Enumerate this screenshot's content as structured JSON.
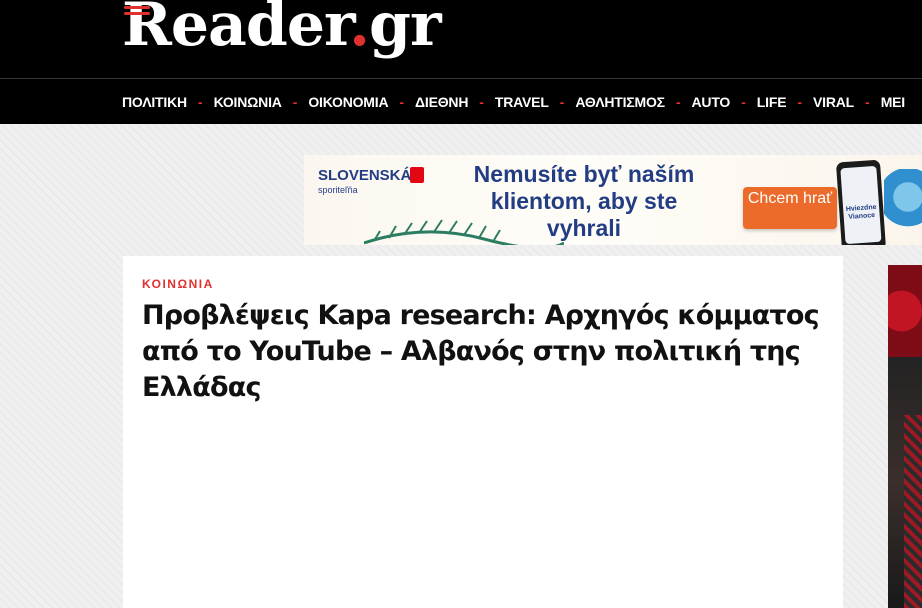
{
  "site": {
    "logo_main": "Reader",
    "logo_dot": ".",
    "logo_tld": "gr"
  },
  "nav": {
    "items": [
      "ΠΟΛΙΤΙΚΗ",
      "ΚΟΙΝΩΝΙΑ",
      "ΟΙΚΟΝΟΜΙΑ",
      "ΔΙΕΘΝΗ",
      "TRAVEL",
      "ΑΘΛΗΤΙΣΜΟΣ",
      "AUTO",
      "LIFE",
      "VIRAL",
      "ΜΕΙ"
    ],
    "separator": "-"
  },
  "banner": {
    "brand": "SLOVENSKÁ",
    "brand_sub": "sporiteľňa",
    "headline": "Nemusíte byť naším klientom, aby ste vyhrali",
    "cta": "Chcem hrať",
    "phone_text": "Hviezdne Vianoce"
  },
  "article": {
    "category": "ΚΟΙΝΩΝΙΑ",
    "title": "Προβλέψεις Kapa research: Αρχηγός κόμματος από το YouTube – Αλβανός στην πολιτική της Ελλάδας"
  },
  "colors": {
    "accent": "#e0312f",
    "header_bg": "#000000",
    "banner_blue": "#223d84",
    "banner_cta": "#ec6a2a"
  }
}
